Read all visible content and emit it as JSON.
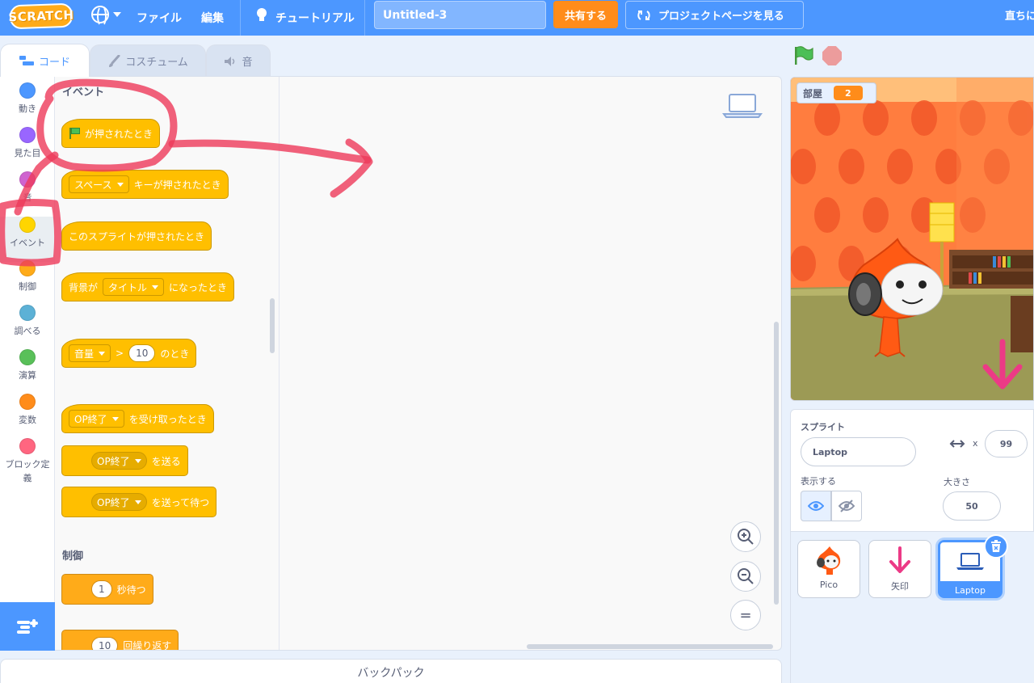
{
  "menubar": {
    "logo": "SCRATCH",
    "file": "ファイル",
    "edit": "編集",
    "tutorials": "チュートリアル",
    "project_title": "Untitled-3",
    "share": "共有する",
    "see_project_page": "プロジェクトページを見る",
    "user": "直ちに"
  },
  "tabs": {
    "code": "コード",
    "costumes": "コスチューム",
    "sounds": "音"
  },
  "categories": [
    {
      "label": "動き",
      "color": "#4c97ff"
    },
    {
      "label": "見た目",
      "color": "#9966ff"
    },
    {
      "label": "音",
      "color": "#cf63cf"
    },
    {
      "label": "イベント",
      "color": "#ffd500"
    },
    {
      "label": "制御",
      "color": "#ffab19"
    },
    {
      "label": "調べる",
      "color": "#5cb1d6"
    },
    {
      "label": "演算",
      "color": "#59c059"
    },
    {
      "label": "変数",
      "color": "#ff8c1a"
    },
    {
      "label": "ブロック定義",
      "color": "#ff6680"
    }
  ],
  "palette": {
    "events_title": "イベント",
    "control_title": "制御",
    "flag_clicked": "が押されたとき",
    "key_dropdown": "スペース",
    "key_pressed": "キーが押されたとき",
    "sprite_clicked": "このスプライトが押されたとき",
    "backdrop_prefix": "背景が",
    "backdrop_dropdown": "タイトル",
    "backdrop_suffix": "になったとき",
    "loudness_dropdown": "音量",
    "gt": ">",
    "loudness_value": "10",
    "loudness_suffix": "のとき",
    "receive_dropdown": "OP終了",
    "receive_suffix": "を受け取ったとき",
    "broadcast_dropdown": "OP終了",
    "broadcast_suffix": "を送る",
    "broadcast_wait_dropdown": "OP終了",
    "broadcast_wait_suffix": "を送って待つ",
    "wait_value": "1",
    "wait_suffix": "秒待つ",
    "repeat_value": "10",
    "repeat_suffix": "回繰り返す"
  },
  "zoom": {
    "in": "+",
    "out": "−",
    "reset": "="
  },
  "backpack": "バックパック",
  "stage": {
    "variable_name": "部屋",
    "variable_value": "2"
  },
  "sprite_info": {
    "sprite_label": "スプライト",
    "sprite_name": "Laptop",
    "x_label": "x",
    "x_value": "99",
    "show_label": "表示する",
    "size_label": "大きさ",
    "size_value": "50"
  },
  "sprites": [
    {
      "name": "Pico"
    },
    {
      "name": "矢印"
    },
    {
      "name": "Laptop"
    }
  ],
  "colors": {
    "menubar": "#4c97ff",
    "events": "#ffbf00",
    "control": "#ffab19",
    "annotation": "#ee3a5a"
  }
}
